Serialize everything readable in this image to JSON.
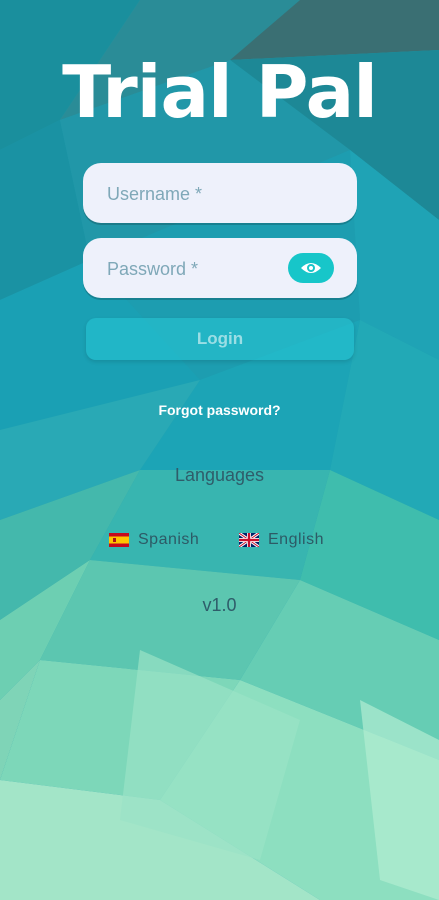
{
  "app": {
    "title": "Trial Pal"
  },
  "form": {
    "username_placeholder": "Username *",
    "username_value": "",
    "password_placeholder": "Password *",
    "password_value": "",
    "password_toggle_icon": "eye-icon",
    "login_label": "Login",
    "forgot_label": "Forgot password?"
  },
  "languages": {
    "title": "Languages",
    "items": [
      {
        "label": "Spanish",
        "flag": "spain-flag-icon"
      },
      {
        "label": "English",
        "flag": "uk-flag-icon"
      }
    ]
  },
  "footer": {
    "version": "v1.0"
  },
  "colors": {
    "accent": "#17c6c9",
    "field_bg": "#eef1fb",
    "text_dark": "#2f5d6a"
  }
}
